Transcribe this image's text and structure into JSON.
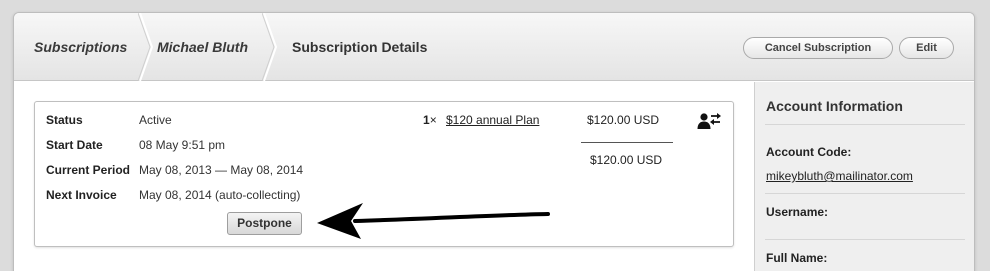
{
  "breadcrumb": {
    "items": [
      {
        "label": "Subscriptions"
      },
      {
        "label": "Michael Bluth"
      },
      {
        "label": "Subscription Details"
      }
    ]
  },
  "header": {
    "cancel_label": "Cancel Subscription",
    "edit_label": "Edit"
  },
  "subscription": {
    "status_label": "Status",
    "status_value": "Active",
    "start_label": "Start Date",
    "start_value": "08 May 9:51 pm",
    "period_label": "Current Period",
    "period_value": "May 08, 2013 — May 08, 2014",
    "invoice_label": "Next Invoice",
    "invoice_value": "May 08, 2014 (auto-collecting)",
    "postpone_label": "Postpone",
    "quantity": "1",
    "quantity_sign": "×",
    "plan_name": "$120 annual Plan",
    "plan_price": "$120.00 USD",
    "total_price": "$120.00 USD",
    "icon": "user-swap-icon"
  },
  "sidebar": {
    "title": "Account Information",
    "account_code_label": "Account Code:",
    "account_code_value": "mikeybluth@mailinator.com",
    "username_label": "Username:",
    "full_name_label": "Full Name:"
  },
  "colors": {
    "background": "#dcdcdc",
    "header": "#e9e9e9",
    "sidebar": "#efefef"
  }
}
